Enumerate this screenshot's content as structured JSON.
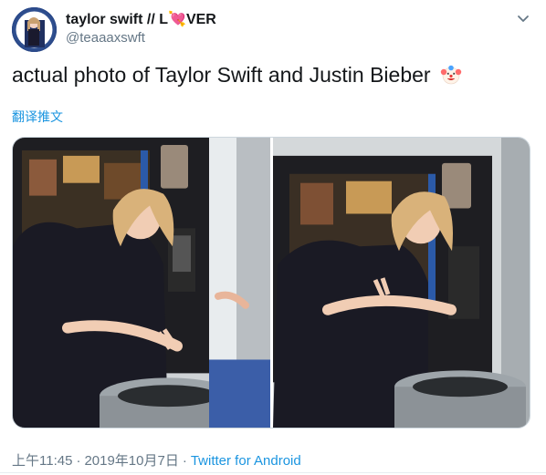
{
  "user": {
    "display_name_prefix": "taylor swift // L",
    "heart": "💘",
    "display_name_suffix": "VER",
    "handle": "@teaaaxswft"
  },
  "tweet": {
    "text": "actual photo of Taylor Swift and Justin Bieber",
    "emoji": "clown-face-icon",
    "translate_label": "翻译推文"
  },
  "meta": {
    "time": "上午11:45",
    "separator": "·",
    "date": "2019年10月7日",
    "source": "Twitter for Android"
  },
  "colors": {
    "link": "#1b95e0",
    "muted": "#657786",
    "text": "#14171a"
  }
}
